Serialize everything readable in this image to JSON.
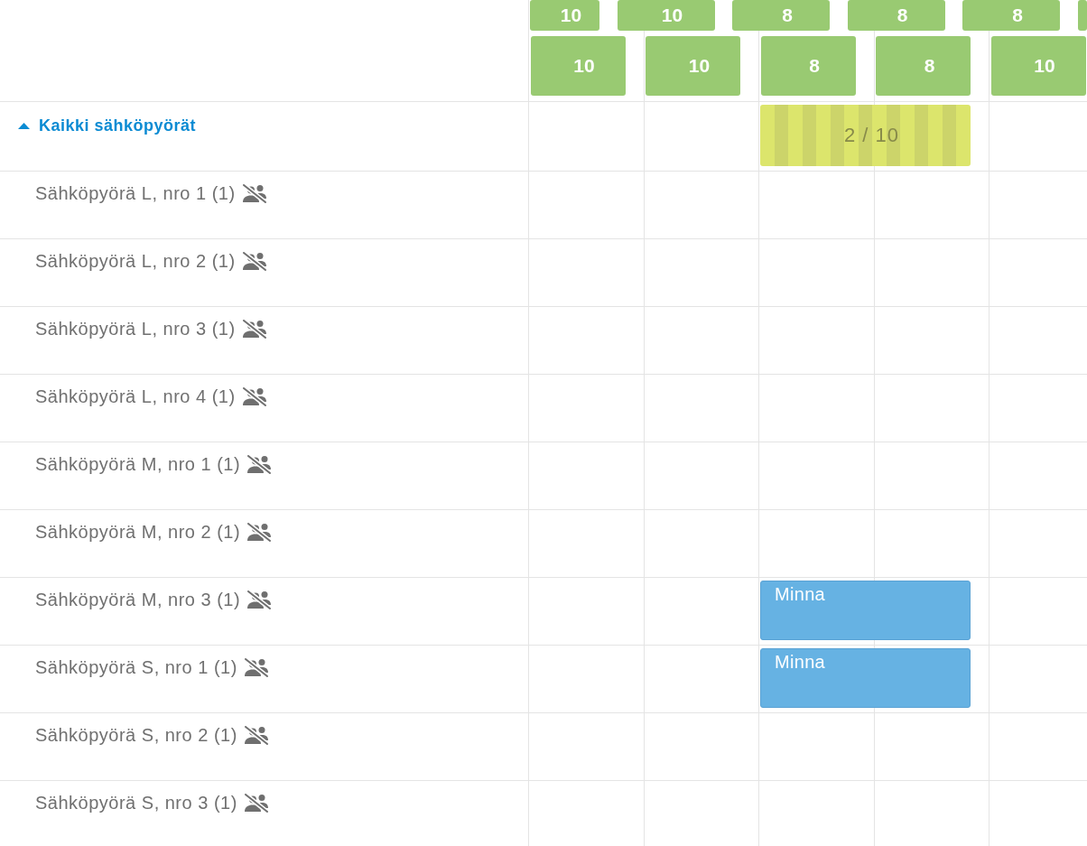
{
  "header": {
    "top_row": [
      {
        "kind": "count",
        "value": "10"
      },
      {
        "kind": "count",
        "value": "10"
      },
      {
        "kind": "count",
        "value": "8"
      },
      {
        "kind": "count",
        "value": "8"
      },
      {
        "kind": "count",
        "value": "8"
      },
      {
        "kind": "edge"
      }
    ],
    "bottom_row": [
      {
        "value": "10"
      },
      {
        "value": "10"
      },
      {
        "value": "8"
      },
      {
        "value": "8"
      },
      {
        "value": "10"
      }
    ]
  },
  "group": {
    "label": "Kaikki sähköpyörät",
    "expanded": true,
    "summary": "2 / 10"
  },
  "items": [
    {
      "label": "Sähköpyörä L, nro 1 (1)"
    },
    {
      "label": "Sähköpyörä L, nro 2 (1)"
    },
    {
      "label": "Sähköpyörä L, nro 3 (1)"
    },
    {
      "label": "Sähköpyörä L, nro 4 (1)"
    },
    {
      "label": "Sähköpyörä M, nro 1 (1)"
    },
    {
      "label": "Sähköpyörä M, nro 2 (1)"
    },
    {
      "label": "Sähköpyörä M, nro 3 (1)",
      "booking": "Minna"
    },
    {
      "label": "Sähköpyörä S, nro 1 (1)",
      "booking": "Minna"
    },
    {
      "label": "Sähköpyörä S, nro 2 (1)"
    },
    {
      "label": "Sähköpyörä S, nro 3 (1)"
    }
  ]
}
